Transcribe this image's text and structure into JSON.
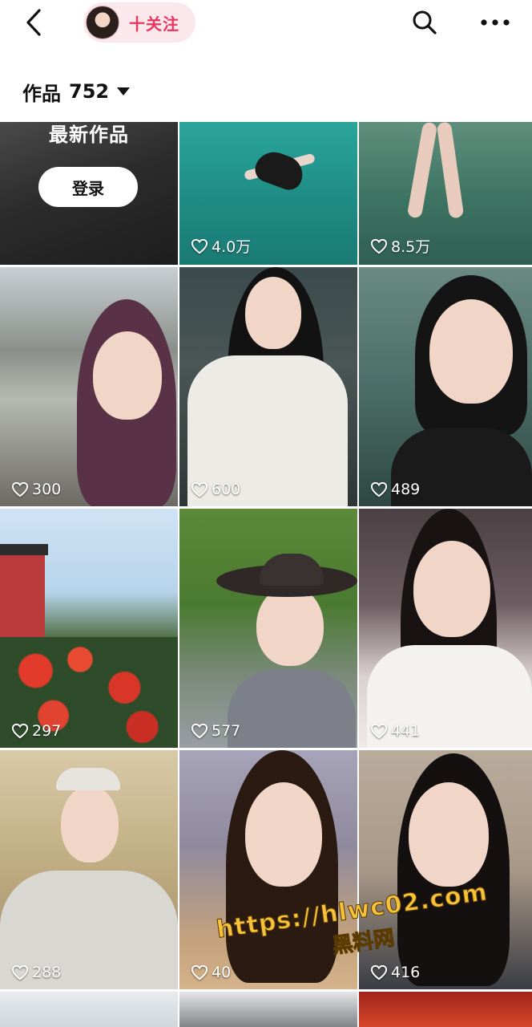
{
  "header": {
    "follow_label": "十关注"
  },
  "works_tab": {
    "label": "作品",
    "count": "752"
  },
  "latest_tile": {
    "title": "最新作品",
    "login_label": "登录"
  },
  "grid": {
    "likes": [
      "4.0万",
      "8.5万",
      "300",
      "600",
      "489",
      "297",
      "577",
      "441",
      "288",
      "40",
      "416"
    ]
  },
  "watermark": {
    "url": "https://hlwc02.com",
    "name": "黑料网"
  },
  "colors": {
    "accent": "#e8365f",
    "follow_bg": "#fbe8ec",
    "watermark": "#f6c23a"
  }
}
